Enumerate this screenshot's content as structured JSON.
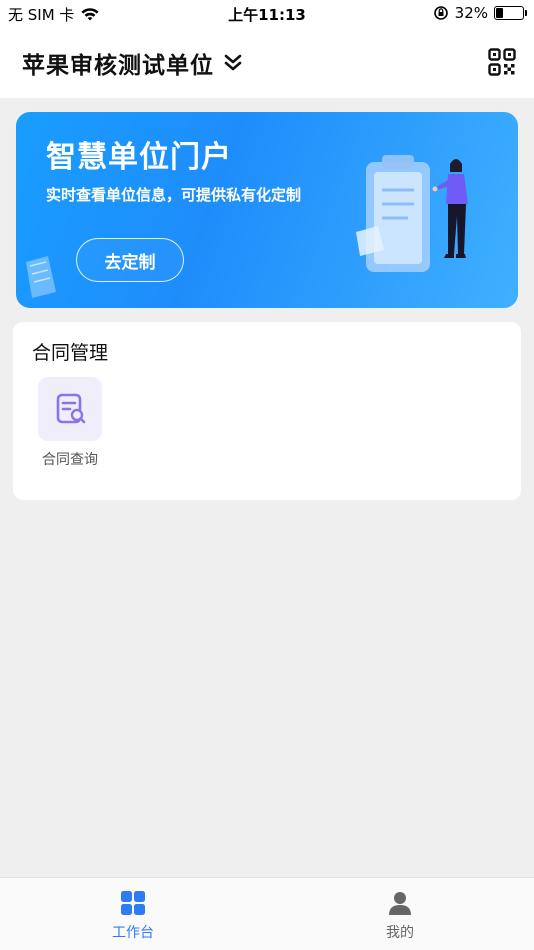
{
  "status_bar": {
    "carrier": "无 SIM 卡",
    "time": "上午11:13",
    "battery_percent": "32%",
    "battery_level": 0.32
  },
  "header": {
    "org_name": "苹果审核测试单位",
    "org_switch_icon": "chevron-double-down-icon",
    "qr_icon": "qr-code-icon"
  },
  "banner": {
    "title": "智慧单位门户",
    "subtitle": "实时查看单位信息，可提供私有化定制",
    "button_label": "去定制"
  },
  "contract_card": {
    "title": "合同管理",
    "items": [
      {
        "label": "合同查询",
        "icon": "contract-search-icon"
      }
    ]
  },
  "tab_bar": {
    "tabs": [
      {
        "label": "工作台",
        "icon": "grid-icon",
        "active": true
      },
      {
        "label": "我的",
        "icon": "user-icon",
        "active": false
      }
    ],
    "active_color": "#2f7bf5",
    "inactive_color": "#666666"
  }
}
